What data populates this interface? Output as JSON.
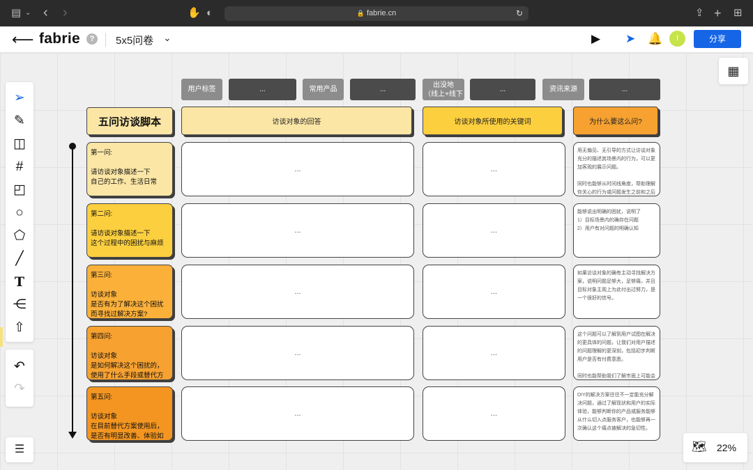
{
  "browser": {
    "url": "fabrie.cn",
    "icons": [
      "sidebar-icon",
      "back-icon",
      "forward-icon",
      "share-icon",
      "new-tab-icon",
      "tab-overview-icon"
    ]
  },
  "header": {
    "logo": "fabrie",
    "help": "?",
    "doc_title": "5x5问卷",
    "avatar_initial": "I",
    "share_label": "分享"
  },
  "tags": [
    {
      "label": "用户标签",
      "kind": "gray"
    },
    {
      "label": "...",
      "kind": "dark"
    },
    {
      "label": "常用产品",
      "kind": "gray"
    },
    {
      "label": "...",
      "kind": "dark"
    },
    {
      "label": "出没地\n（线上+线下",
      "kind": "gray"
    },
    {
      "label": "...",
      "kind": "dark"
    },
    {
      "label": "资讯来源",
      "kind": "gray"
    },
    {
      "label": "...",
      "kind": "dark"
    }
  ],
  "board": {
    "title": "五问访谈脚本",
    "col_answer": "访谈对象的回答",
    "col_keywords": "访谈对象所使用的关键词",
    "col_why": "为什么要这么问?",
    "ellipsis": "...",
    "questions": [
      {
        "num": "第一问:",
        "text": "请访谈对象描述一下\n自己的工作、生活日常",
        "color": "#fbe6a6"
      },
      {
        "num": "第二问:",
        "text": "请访谈对象描述一下\n这个过程中的困扰与麻烦",
        "color": "#fccf3f"
      },
      {
        "num": "第三问:",
        "text": "访谈对象\n是否有为了解决这个困扰而寻找过解决方案?",
        "color": "#fbb03a"
      },
      {
        "num": "第四问:",
        "text": "访谈对象\n是如何解决这个困扰的，使用了什么手段或替代方案?",
        "color": "#f6a130"
      },
      {
        "num": "第五问:",
        "text": "访谈对象\n在目前替代方案使用后，是否有明显改善、体验如何?",
        "color": "#f39520"
      }
    ],
    "whys": [
      "用无偏见、无引导的方式让访谈对象充分的描述其场景内的行为，可以更加客观的展示问题。\n\n同时也能够从时间线角度，帮助理解你关心的行为或问题发生之前和之后",
      "能够说出明确的困扰，说明了\n1）目标场景内的确存在问题\n2）用户有对问题的明确认知",
      "如果访谈对象的确有主动寻找解决方案，说明问题足够大，足够痛，并且目标对象主观上为此付出过努力，是一个很好的信号。",
      "这个问题可以了解到用户试图在解决的更具体的问题，让我们对用户描述的问题理解的更深刻，包括初步判断用户是否有付费意愿。\n\n同时也能帮助我们了解市面上可能会有的竞品和替代方案",
      "DIY的解决方案往往不一定能充分解决问题，通过了解现状和用户的实际体验，能够判断你的产品或服务能够从什么切入点服务客户，也能够再一次确认这个痛点被解决的急切性。"
    ]
  },
  "zoom": {
    "value": "22%"
  },
  "colors": {
    "share": "#1565e6",
    "avatar": "#c6e34a",
    "col_answer": "#fbe6a6",
    "col_keywords": "#fccf3f",
    "col_why": "#f6a130"
  }
}
